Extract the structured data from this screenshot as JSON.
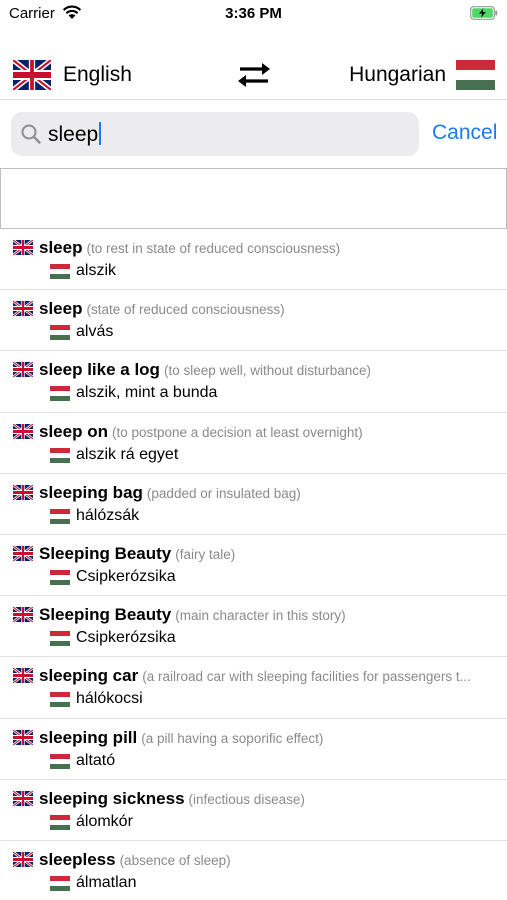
{
  "status_bar": {
    "carrier": "Carrier",
    "time": "3:36 PM"
  },
  "language_bar": {
    "source": "English",
    "target": "Hungarian"
  },
  "search": {
    "value": "sleep",
    "cancel_label": "Cancel"
  },
  "colors": {
    "accent": "#1a7cf5",
    "note_gray": "#8a8a8a",
    "hu_red": "#ce2939",
    "hu_green": "#477050",
    "uk_blue": "#012169",
    "uk_red": "#c8102e"
  },
  "results": [
    {
      "term": "sleep",
      "note": "(to rest in state of reduced consciousness)",
      "translation": "alszik"
    },
    {
      "term": "sleep",
      "note": "(state of reduced consciousness)",
      "translation": "alvás"
    },
    {
      "term": "sleep like a log",
      "note": "(to sleep well, without disturbance)",
      "translation": "alszik, mint a bunda"
    },
    {
      "term": "sleep on",
      "note": "(to postpone a decision at least overnight)",
      "translation": "alszik rá egyet"
    },
    {
      "term": "sleeping bag",
      "note": "(padded or insulated bag)",
      "translation": "hálózsák"
    },
    {
      "term": "Sleeping Beauty",
      "note": "(fairy tale)",
      "translation": "Csipkerózsika"
    },
    {
      "term": "Sleeping Beauty",
      "note": "(main character in this story)",
      "translation": "Csipkerózsika"
    },
    {
      "term": "sleeping car",
      "note": "(a railroad car with sleeping facilities for passengers t...",
      "translation": "hálókocsi"
    },
    {
      "term": "sleeping pill",
      "note": "(a pill having a soporific effect)",
      "translation": "altató"
    },
    {
      "term": "sleeping sickness",
      "note": "(infectious disease)",
      "translation": "álomkór"
    },
    {
      "term": "sleepless",
      "note": "(absence of sleep)",
      "translation": "álmatlan"
    }
  ]
}
